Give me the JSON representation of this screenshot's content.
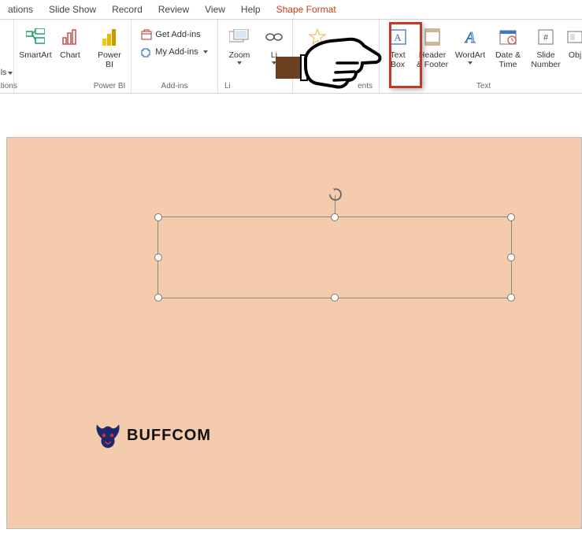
{
  "tabs": {
    "animations": "ations",
    "slideshow": "Slide Show",
    "record": "Record",
    "review": "Review",
    "view": "View",
    "help": "Help",
    "shape_format": "Shape Format"
  },
  "ribbon": {
    "partial_group_left": "ations",
    "power_bi_group": "Power BI",
    "addins_group": "Add-ins",
    "links_group": "Li",
    "comments_group": "ents",
    "text_group": "Text",
    "buttons": {
      "smartart": "SmartArt",
      "chart": "Chart",
      "power_bi": "Power\nBI",
      "zoom": "Zoom",
      "link": "Li",
      "text_box": "Text\nBox",
      "header_footer": "Header\n& Footer",
      "wordart": "WordArt",
      "date_time": "Date &\nTime",
      "slide_number": "Slide\nNumber",
      "object": "Obj"
    },
    "addins": {
      "get": "Get Add-ins",
      "my": "My Add-ins"
    },
    "partial_ls": "ls"
  },
  "logo": {
    "text": "BUFFCOM"
  }
}
